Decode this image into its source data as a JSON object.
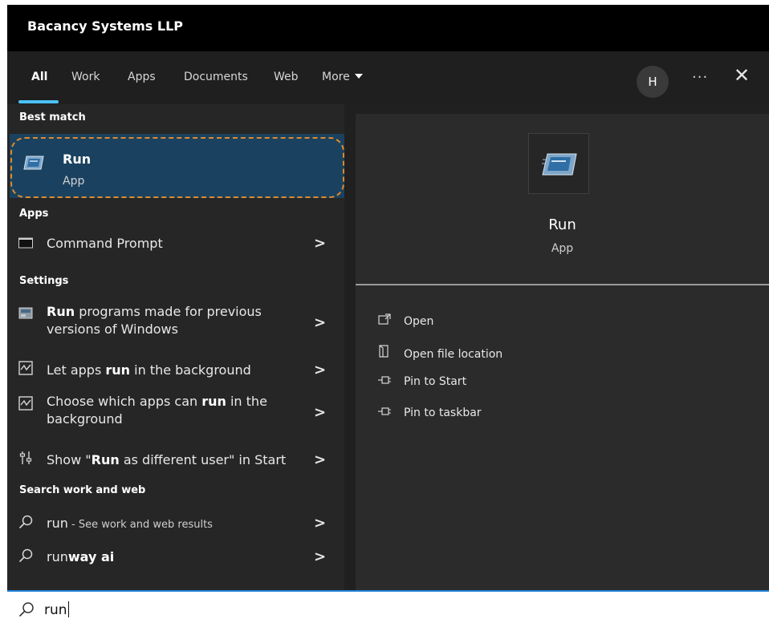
{
  "window": {
    "org_name": "Bacancy Systems LLP"
  },
  "tabs": [
    {
      "label": "All"
    },
    {
      "label": "Work"
    },
    {
      "label": "Apps"
    },
    {
      "label": "Documents"
    },
    {
      "label": "Web"
    },
    {
      "label": "More"
    }
  ],
  "header": {
    "avatar_initial": "H",
    "more_label": "···",
    "close_label": "✕"
  },
  "left": {
    "best_match_heading": "Best match",
    "best_match": {
      "title": "Run",
      "subtitle": "App"
    },
    "apps_heading": "Apps",
    "apps": [
      {
        "label": "Command Prompt"
      }
    ],
    "settings_heading": "Settings",
    "settings": [
      {
        "pre": "",
        "bold": "Run",
        "post": " programs made for previous",
        "line2": "versions of Windows"
      },
      {
        "pre": "Let apps ",
        "bold": "run",
        "post": " in the background",
        "line2": ""
      },
      {
        "pre": "Choose which apps can ",
        "bold": "run",
        "post": " in the",
        "line2": "background"
      },
      {
        "pre": "Show \"",
        "bold": "Run",
        "post": " as different user\" in Start",
        "line2": ""
      }
    ],
    "web_heading": "Search work and web",
    "web": [
      {
        "pre": "run",
        "bold": "",
        "suffix": " - See work and web results"
      },
      {
        "pre": "run",
        "bold": "way ai",
        "suffix": ""
      }
    ],
    "chevron": ">"
  },
  "right": {
    "title": "Run",
    "subtitle": "App",
    "actions": [
      {
        "label": "Open"
      },
      {
        "label": "Open file location"
      },
      {
        "label": "Pin to Start"
      },
      {
        "label": "Pin to taskbar"
      }
    ]
  },
  "search": {
    "value": "run"
  },
  "colors": {
    "accent": "#4cc2ff",
    "highlight": "#1a4260",
    "outline": "#e0892c"
  }
}
